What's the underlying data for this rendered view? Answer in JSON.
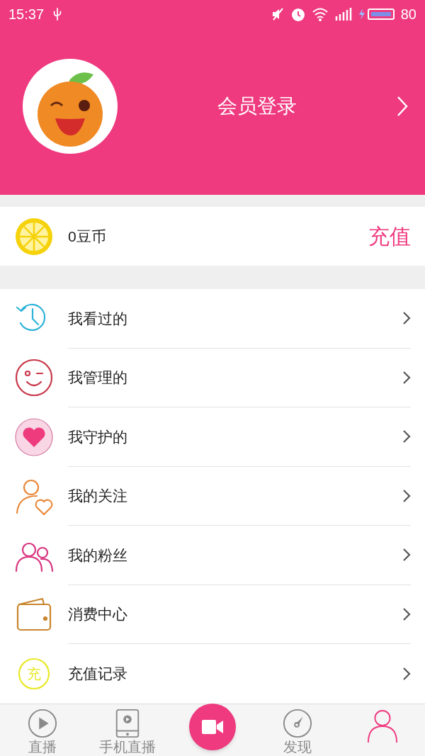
{
  "status_bar": {
    "time": "15:37",
    "battery": "80"
  },
  "header": {
    "login_label": "会员登录"
  },
  "wallet": {
    "balance": "0豆币",
    "recharge": "充值"
  },
  "menu": [
    {
      "kind": "clock",
      "label": "我看过的",
      "color": "#2fb3d9"
    },
    {
      "kind": "wink",
      "label": "我管理的",
      "color": "#c8384a"
    },
    {
      "kind": "heart",
      "label": "我守护的",
      "color": "#ee3b7e"
    },
    {
      "kind": "user-heart",
      "label": "我的关注",
      "color": "#e8893a"
    },
    {
      "kind": "users",
      "label": "我的粉丝",
      "color": "#d9357f"
    },
    {
      "kind": "wallet",
      "label": "消费中心",
      "color": "#c8862e"
    },
    {
      "kind": "charge",
      "label": "充值记录",
      "color": "#e8e82a",
      "icon_text": "充"
    }
  ],
  "bottom_nav": [
    {
      "kind": "play",
      "label": "直播",
      "selected": false
    },
    {
      "kind": "tablet",
      "label": "手机直播",
      "selected": false
    },
    {
      "kind": "camera",
      "selected": false
    },
    {
      "kind": "compass",
      "label": "发现",
      "selected": false
    },
    {
      "kind": "person",
      "selected": true
    }
  ]
}
